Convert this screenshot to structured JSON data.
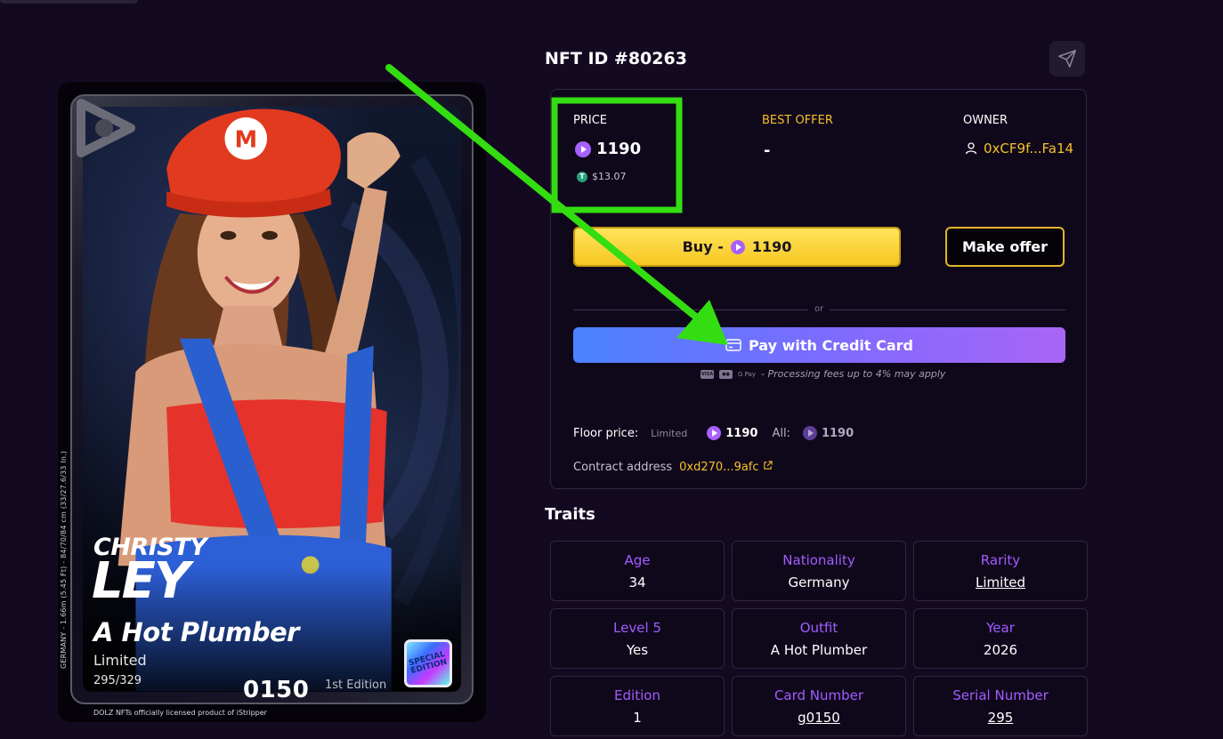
{
  "nft": {
    "id_title": "NFT ID #80263"
  },
  "price": {
    "price_label": "PRICE",
    "price_value": "1190",
    "usd_value": "$13.07",
    "best_offer_label": "BEST OFFER",
    "best_offer_value": "-",
    "owner_label": "OWNER",
    "owner_value": "0xCF9f...Fa14"
  },
  "actions": {
    "buy_label": "Buy  -",
    "buy_value": "1190",
    "make_offer_label": "Make offer",
    "or_label": "or",
    "credit_card_label": "Pay with Credit Card",
    "fees_note": "- Processing fees up to 4% may apply",
    "payment_icons": [
      "visa-icon",
      "mastercard-icon",
      "gpay-icon"
    ],
    "visa_text": "VISA",
    "gpay_text": "G Pay"
  },
  "floor": {
    "label": "Floor price:",
    "limited_label": "Limited",
    "limited_value": "1190",
    "all_label": "All:",
    "all_value": "1190"
  },
  "contract": {
    "label": "Contract address",
    "value": "0xd270...9afc"
  },
  "traits": {
    "title": "Traits",
    "items": [
      {
        "label": "Age",
        "value": "34",
        "link": false
      },
      {
        "label": "Nationality",
        "value": "Germany",
        "link": false
      },
      {
        "label": "Rarity",
        "value": "Limited",
        "link": true
      },
      {
        "label": "Level 5",
        "value": "Yes",
        "link": false
      },
      {
        "label": "Outfit",
        "value": "A Hot Plumber",
        "link": false
      },
      {
        "label": "Year",
        "value": "2026",
        "link": false
      },
      {
        "label": "Edition",
        "value": "1",
        "link": false
      },
      {
        "label": "Card Number",
        "value": "g0150",
        "link": true
      },
      {
        "label": "Serial Number",
        "value": "295",
        "link": true
      }
    ]
  },
  "card": {
    "first_name": "CHRISTY",
    "last_name": "LEY",
    "title": "A Hot Plumber",
    "rarity": "Limited",
    "serial": "295/329",
    "number": "0150",
    "edition": "1st Edition",
    "vertical_info": "GERMANY - 1.66m (5.45 Ft) - 84/70/84 cm (33/27.6/33 In.)",
    "special_badge": "SPECIAL EDITION",
    "license": "DOLZ NFTs officially licensed product of iStripper",
    "hat_letter": "M"
  },
  "colors": {
    "accent_yellow": "#f7c12b",
    "accent_purple": "#a35cff",
    "highlight_green": "#33dd11",
    "background": "#130a22"
  }
}
